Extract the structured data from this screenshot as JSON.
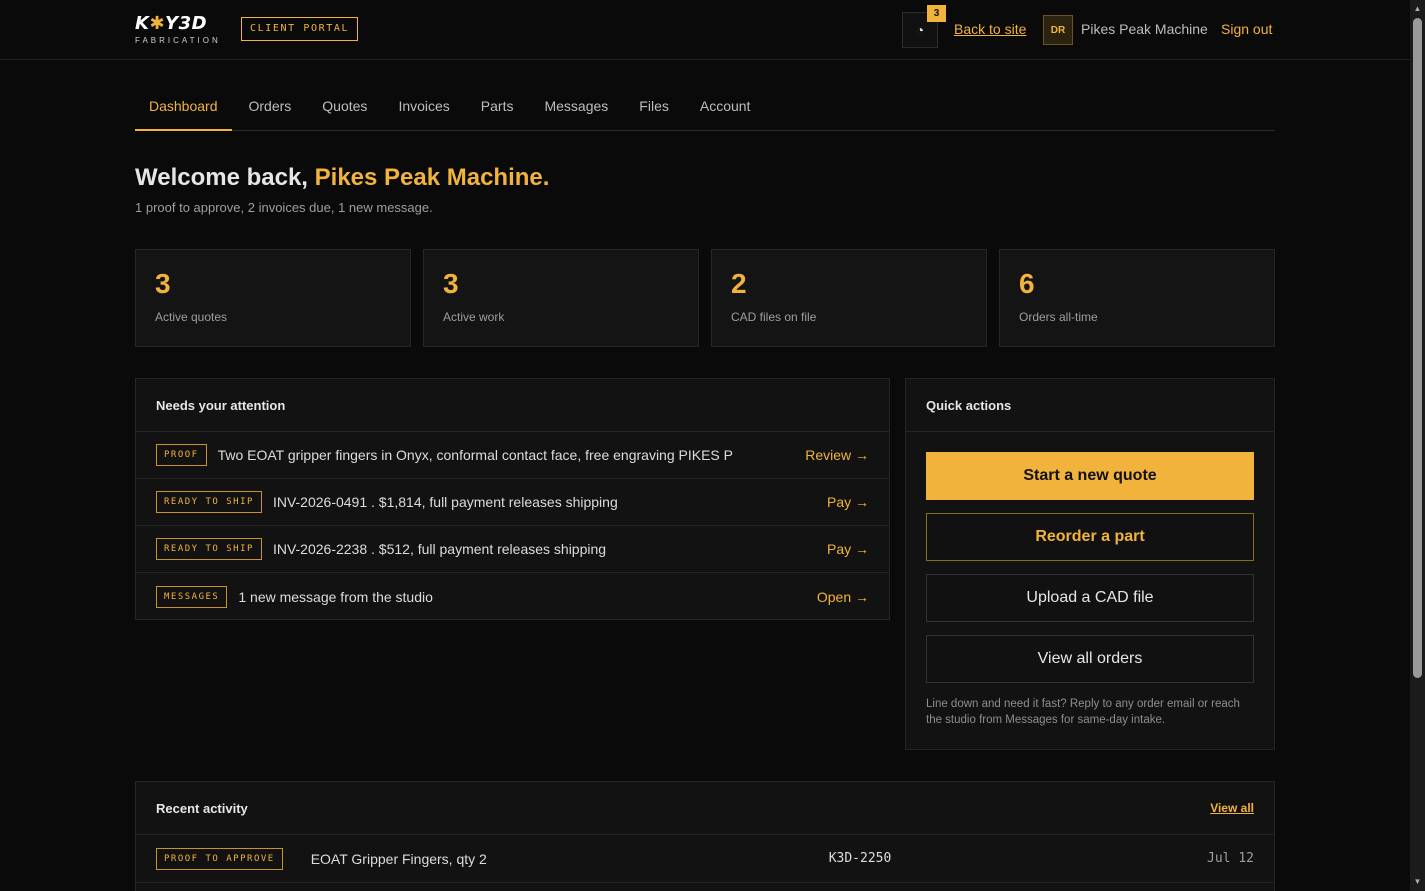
{
  "brand": {
    "logo_main_left": "K",
    "logo_star": "✱",
    "logo_main_right": "Y3D",
    "logo_sub": "FABRICATION",
    "portal_badge": "CLIENT PORTAL"
  },
  "header": {
    "notification_count": "3",
    "back_link": "Back to site",
    "avatar_initials": "DR",
    "account_name": "Pikes Peak Machine",
    "sign_out": "Sign out"
  },
  "tabs": [
    {
      "label": "Dashboard",
      "active": true
    },
    {
      "label": "Orders"
    },
    {
      "label": "Quotes"
    },
    {
      "label": "Invoices"
    },
    {
      "label": "Parts"
    },
    {
      "label": "Messages"
    },
    {
      "label": "Files"
    },
    {
      "label": "Account"
    }
  ],
  "welcome": {
    "prefix": "Welcome back, ",
    "name": "Pikes Peak Machine.",
    "subtitle": "1 proof to approve, 2 invoices due, 1 new message."
  },
  "stats": [
    {
      "value": "3",
      "label": "Active quotes"
    },
    {
      "value": "3",
      "label": "Active work"
    },
    {
      "value": "2",
      "label": "CAD files on file"
    },
    {
      "value": "6",
      "label": "Orders all-time"
    }
  ],
  "attention": {
    "title": "Needs your attention",
    "rows": [
      {
        "tag": "PROOF",
        "text": "Two EOAT gripper fingers in Onyx, conformal contact face, free engraving PIKES P",
        "action": "Review →"
      },
      {
        "tag": "READY TO SHIP",
        "text": "INV-2026-0491 . $1,814, full payment releases shipping",
        "action": "Pay →"
      },
      {
        "tag": "READY TO SHIP",
        "text": "INV-2026-2238 . $512, full payment releases shipping",
        "action": "Pay →"
      },
      {
        "tag": "MESSAGES",
        "text": "1 new message from the studio",
        "action": "Open →"
      }
    ]
  },
  "quick_actions": {
    "title": "Quick actions",
    "start_quote": "Start a new quote",
    "reorder": "Reorder a part",
    "upload": "Upload a CAD file",
    "view_orders": "View all orders",
    "note": "Line down and need it fast? Reply to any order email or reach the studio from Messages for same-day intake."
  },
  "recent": {
    "title": "Recent activity",
    "view_all": "View all",
    "rows": [
      {
        "tag": "PROOF TO APPROVE",
        "desc": "EOAT Gripper Fingers, qty 2",
        "id": "K3D-2250",
        "date": "Jul 12"
      }
    ]
  },
  "colors": {
    "accent": "#f2b33d",
    "background": "#0a0a0a",
    "panel": "#121212"
  }
}
